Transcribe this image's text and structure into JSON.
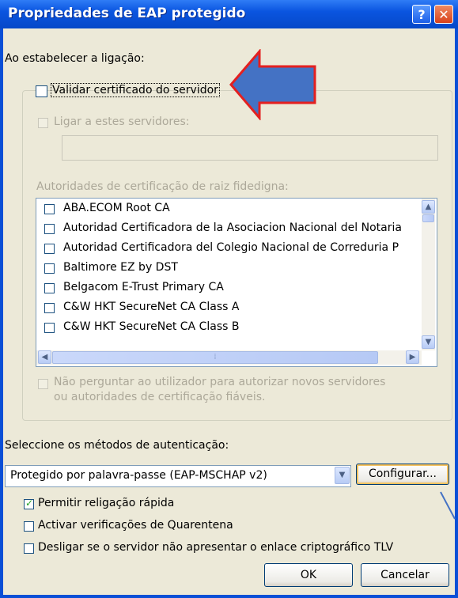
{
  "window": {
    "title": "Propriedades de EAP protegido",
    "help_glyph": "?",
    "close_glyph": "✕"
  },
  "connect_heading": "Ao estabelecer a ligação:",
  "validate_cert": {
    "label": "Validar certificado do servidor",
    "checked": false
  },
  "connect_servers": {
    "label": "Ligar a estes servidores:",
    "value": ""
  },
  "trusted_roots": {
    "label": "Autoridades de certificação de raiz fidedigna:",
    "items": [
      "ABA.ECOM Root CA",
      "Autoridad Certificadora de la Asociacion Nacional del Notaria",
      "Autoridad Certificadora del Colegio Nacional de Correduria P",
      "Baltimore EZ by DST",
      "Belgacom E-Trust Primary CA",
      "C&W HKT SecureNet CA Class A",
      "C&W HKT SecureNet CA Class B"
    ]
  },
  "no_prompt": {
    "line1": "Não perguntar ao utilizador para autorizar novos servidores",
    "line2": "ou autoridades de certificação fiáveis."
  },
  "auth_methods": {
    "label": "Seleccione os métodos de autenticação:",
    "selected": "Protegido por palavra-passe (EAP-MSCHAP v2)",
    "configure_label": "Configurar..."
  },
  "options": [
    {
      "label": "Permitir religação rápida",
      "checked": true
    },
    {
      "label": "Activar verificações de Quarentena",
      "checked": false
    },
    {
      "label": "Desligar se o servidor não apresentar o enlace criptográfico TLV",
      "checked": false
    }
  ],
  "buttons": {
    "ok": "OK",
    "cancel": "Cancelar"
  },
  "glyphs": {
    "check": "✓",
    "up": "▲",
    "down": "▼",
    "left": "◀",
    "right": "▶",
    "grip": "⁞"
  },
  "colors": {
    "annotation_arrow_fill": "#4472c4",
    "annotation_arrow_stroke": "#e32020",
    "title_bar": "#0a55e0",
    "dialog_bg": "#ece9d8"
  }
}
